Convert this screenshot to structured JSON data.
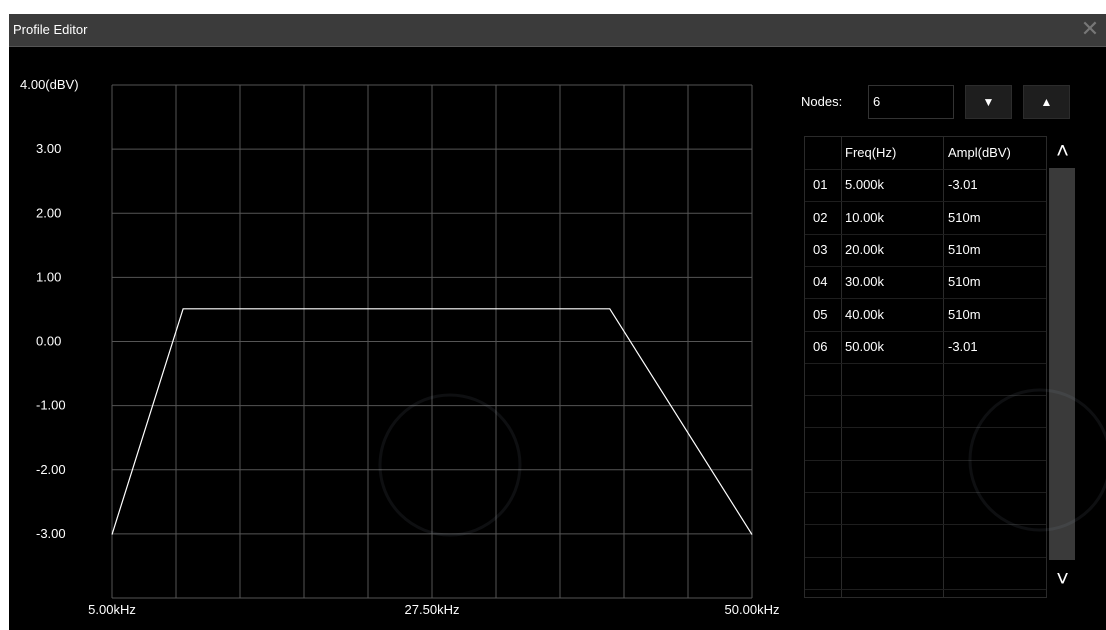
{
  "window": {
    "title": "Profile Editor",
    "close_icon": "close-icon"
  },
  "nodes": {
    "label": "Nodes:",
    "value": "6",
    "down_icon": "triangle-down-icon",
    "up_icon": "triangle-up-icon"
  },
  "table": {
    "headers": [
      "",
      "Freq(Hz)",
      "Ampl(dBV)"
    ],
    "rows": [
      [
        "01",
        "5.000k",
        "-3.01"
      ],
      [
        "02",
        "10.00k",
        "510m"
      ],
      [
        "03",
        "20.00k",
        "510m"
      ],
      [
        "04",
        "30.00k",
        "510m"
      ],
      [
        "05",
        "40.00k",
        "510m"
      ],
      [
        "06",
        "50.00k",
        "-3.01"
      ]
    ],
    "empty_rows": 7
  },
  "scroll": {
    "up_icon": "chevron-up-icon",
    "down_icon": "chevron-down-icon"
  },
  "chart_data": {
    "type": "line",
    "x_tick_labels": [
      "5.00kHz",
      "27.50kHz",
      "50.00kHz"
    ],
    "y_tick_labels": [
      "4.00(dBV)",
      "3.00",
      "2.00",
      "1.00",
      "0.00",
      "-1.00",
      "-2.00",
      "-3.00"
    ],
    "xlim": [
      5000,
      50000
    ],
    "ylim": [
      -4,
      4
    ],
    "grid": true,
    "series": [
      {
        "x": [
          5000,
          10000,
          20000,
          30000,
          40000,
          50000
        ],
        "y": [
          -3.01,
          0.51,
          0.51,
          0.51,
          0.51,
          -3.01
        ]
      }
    ],
    "line_color": "#ffffff",
    "grid_color": "#555555"
  }
}
